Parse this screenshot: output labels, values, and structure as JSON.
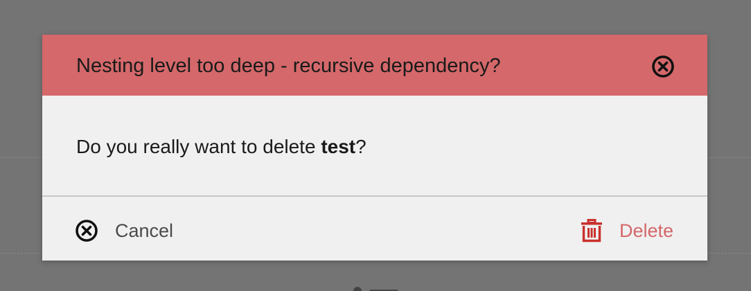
{
  "dialog": {
    "title": "Nesting level too deep - recursive dependency?",
    "message_prefix": "Do you really want to delete ",
    "message_target": "test",
    "message_suffix": "?",
    "close_icon": "close-circle-icon"
  },
  "footer": {
    "cancel_label": "Cancel",
    "cancel_icon": "close-circle-icon",
    "delete_label": "Delete",
    "delete_icon": "trash-icon"
  },
  "colors": {
    "header_background": "#d4686a",
    "dialog_background": "#f0f0f0",
    "danger": "#d4686a",
    "trash_icon": "#c9302c",
    "overlay": "#747474"
  }
}
